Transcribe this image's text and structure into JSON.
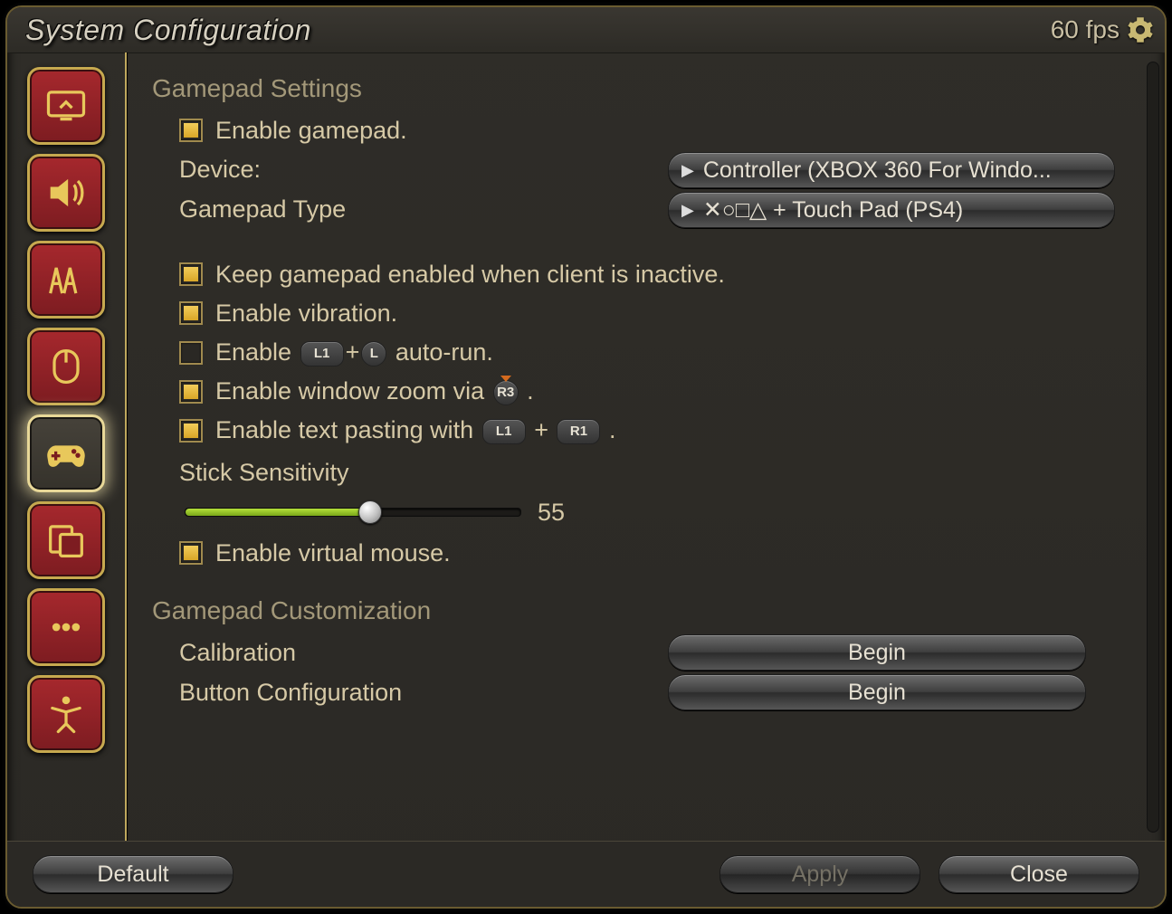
{
  "title": "System Configuration",
  "fps_label": "60 fps",
  "sidebar": {
    "items": [
      {
        "name": "display",
        "selected": false
      },
      {
        "name": "sound",
        "selected": false
      },
      {
        "name": "graphics",
        "selected": false
      },
      {
        "name": "mouse",
        "selected": false
      },
      {
        "name": "gamepad",
        "selected": true
      },
      {
        "name": "themes",
        "selected": false
      },
      {
        "name": "other",
        "selected": false
      },
      {
        "name": "accessibility",
        "selected": false
      }
    ]
  },
  "section1_heading": "Gamepad Settings",
  "enable_gamepad": {
    "checked": true,
    "label": "Enable gamepad."
  },
  "device": {
    "key": "Device:",
    "value": "Controller (XBOX 360 For Windo..."
  },
  "gamepad_type": {
    "key": "Gamepad Type",
    "value": "✕○□△ + Touch Pad (PS4)"
  },
  "keep_enabled": {
    "checked": true,
    "label": "Keep gamepad enabled when client is inactive."
  },
  "vibration": {
    "checked": true,
    "label": "Enable vibration."
  },
  "autorun": {
    "checked": false,
    "label_pre": "Enable ",
    "glyph1": "L1",
    "glyph2": "L",
    "label_post": " auto-run."
  },
  "window_zoom": {
    "checked": true,
    "label_pre": "Enable window zoom via ",
    "glyph": "R3",
    "label_post": " ."
  },
  "text_paste": {
    "checked": true,
    "label_pre": "Enable text pasting with ",
    "glyph1": "L1",
    "plus": " + ",
    "glyph2": "R1",
    "label_post": " ."
  },
  "stick": {
    "label": "Stick Sensitivity",
    "value": 55,
    "min": 0,
    "max": 100,
    "fill_percent": 55
  },
  "virtual_mouse": {
    "checked": true,
    "label": "Enable virtual mouse."
  },
  "section2_heading": "Gamepad Customization",
  "calibration": {
    "key": "Calibration",
    "button": "Begin"
  },
  "button_config": {
    "key": "Button Configuration",
    "button": "Begin"
  },
  "footer": {
    "default": "Default",
    "apply": "Apply",
    "close": "Close",
    "apply_enabled": false
  }
}
